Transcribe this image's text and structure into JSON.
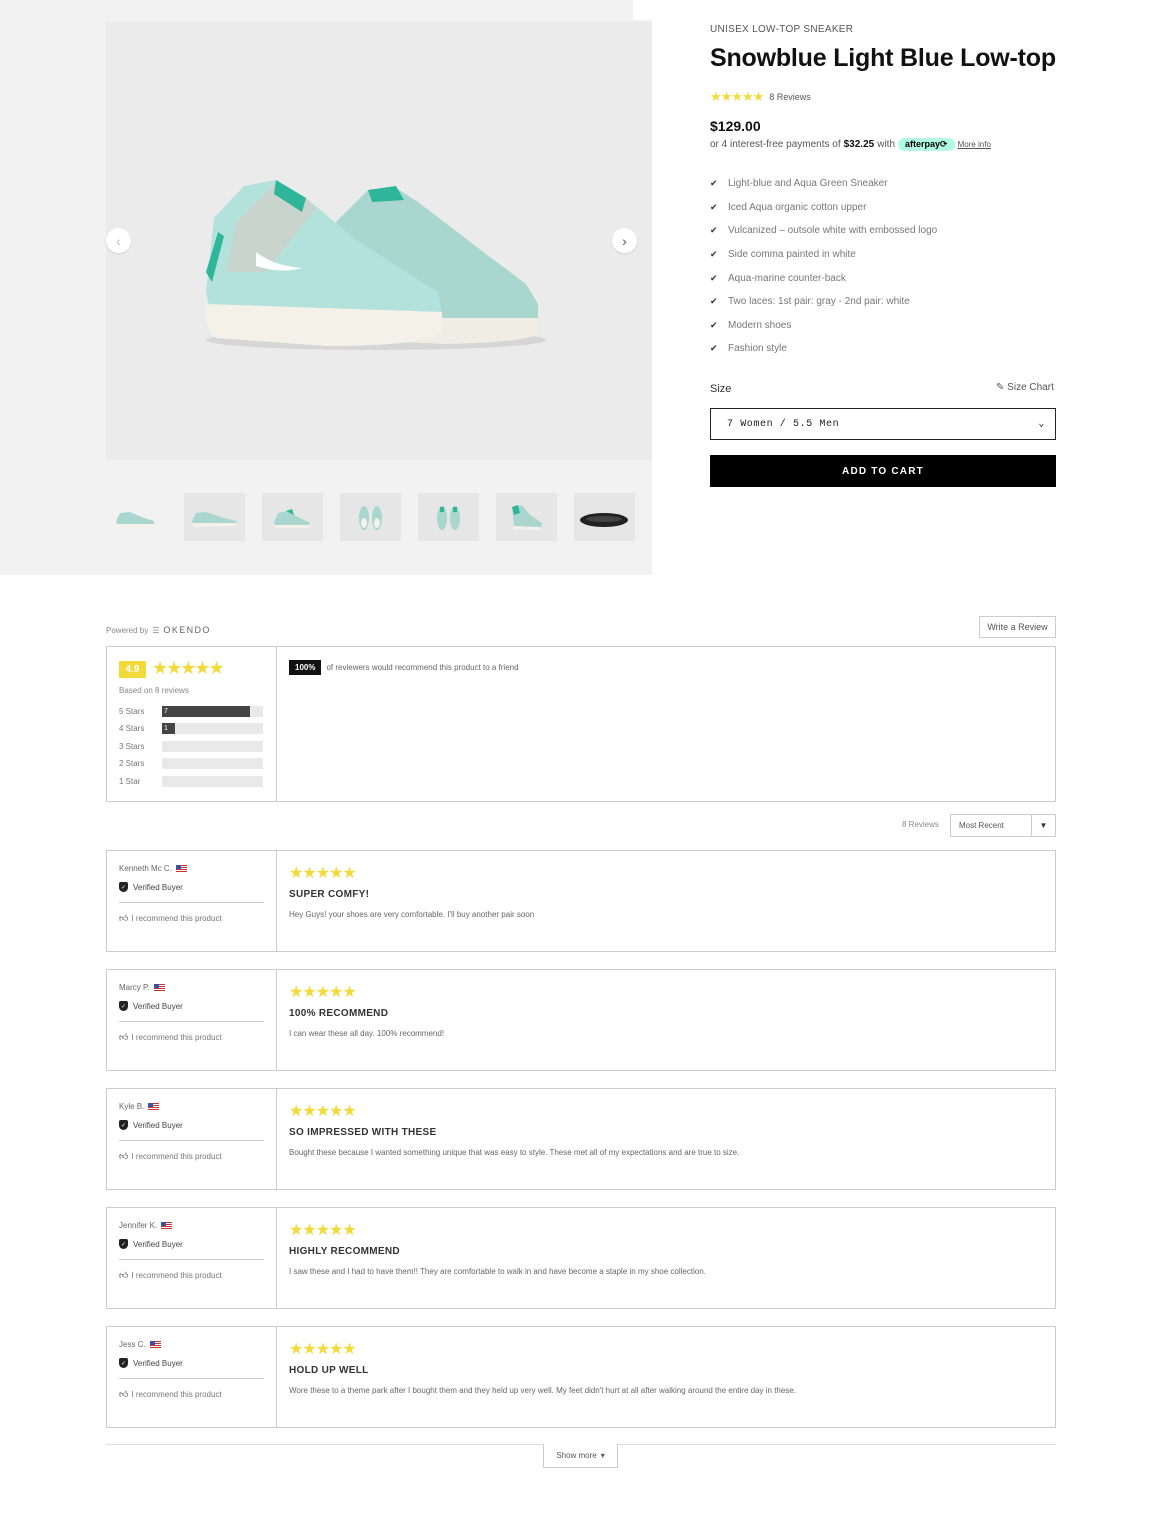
{
  "product": {
    "kicker": "UNISEX LOW-TOP SNEAKER",
    "title": "Snowblue Light Blue Low-top",
    "rating_stars": "★★★★★",
    "reviews_link": "8 Reviews",
    "price": "$129.00",
    "afterpay": {
      "prefix": "or 4 interest-free payments of",
      "amount": "$32.25",
      "with": "with",
      "badge": "afterpay⟳",
      "more_info": "More info"
    },
    "features": [
      "Light-blue and Aqua Green Sneaker",
      "Iced Aqua organic cotton upper",
      "Vulcanized – outsole white with embossed logo",
      "Side comma painted in white",
      "Aqua-marine counter-back",
      "Two laces: 1st pair: gray - 2nd pair: white",
      "Modern shoes",
      "Fashion style"
    ],
    "size_label": "Size",
    "size_chart": "Size Chart",
    "size_value": "7 Women / 5.5 Men",
    "add_to_cart": "ADD TO CART"
  },
  "gallery": {
    "prev_icon": "chevron-left-icon",
    "next_icon": "chevron-right-icon",
    "thumbnails": [
      "sneaker-pair-side",
      "sneaker-single-side",
      "sneaker-pair-angle",
      "sneaker-pair-front",
      "sneaker-pair-back",
      "sneaker-single-angle",
      "sneaker-sole"
    ]
  },
  "reviews": {
    "powered_by": "Powered by",
    "provider": "OKENDO",
    "write_review": "Write a Review",
    "average": "4.9",
    "summary_stars": "★★★★★",
    "based_on": "Based on 8 reviews",
    "distribution": [
      {
        "label": "5 Stars",
        "count": "7",
        "fraction": 0.875
      },
      {
        "label": "4 Stars",
        "count": "1",
        "fraction": 0.125
      },
      {
        "label": "3 Stars",
        "count": "0",
        "fraction": 0
      },
      {
        "label": "2 Stars",
        "count": "0",
        "fraction": 0
      },
      {
        "label": "1 Star",
        "count": "0",
        "fraction": 0
      }
    ],
    "recommend_percent": "100%",
    "recommend_text": "of reviewers would recommend this product to a friend",
    "count_label": "8 Reviews",
    "sort_value": "Most Recent",
    "show_more": "Show more",
    "items": [
      {
        "name": "Kenneth Mc C.",
        "verified": "Verified Buyer",
        "recommend": "I recommend this product",
        "stars": "★★★★★",
        "title": "SUPER COMFY!",
        "body": "Hey Guys! your shoes are very comfortable. I'll buy another pair soon"
      },
      {
        "name": "Marcy P.",
        "verified": "Verified Buyer",
        "recommend": "I recommend this product",
        "stars": "★★★★★",
        "title": "100% RECOMMEND",
        "body": "I can wear these all day. 100% recommend!"
      },
      {
        "name": "Kyle B.",
        "verified": "Verified Buyer",
        "recommend": "I recommend this product",
        "stars": "★★★★★",
        "title": "SO IMPRESSED WITH THESE",
        "body": "Bought these because I wanted something unique that was easy to style. These met all of my expectations and are true to size."
      },
      {
        "name": "Jennifer K.",
        "verified": "Verified Buyer",
        "recommend": "I recommend this product",
        "stars": "★★★★★",
        "title": "HIGHLY RECOMMEND",
        "body": "I saw these and I had to have them!! They are comfortable to walk in and have become a staple in my shoe collection."
      },
      {
        "name": "Jess C.",
        "verified": "Verified Buyer",
        "recommend": "I recommend this product",
        "stars": "★★★★★",
        "title": "HOLD UP WELL",
        "body": "Wore these to a theme park after I bought them and they held up very well. My feet didn't hurt at all after walking around the entire day in these."
      }
    ]
  },
  "colors": {
    "star": "#f2da38",
    "button": "#000000",
    "afterpay": "#b2fce4"
  }
}
